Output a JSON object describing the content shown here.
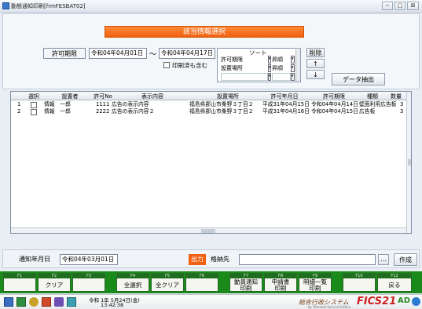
{
  "window": {
    "title": "動態通知印刷[frmFESBAT02]",
    "btn_min": "─",
    "btn_max": "□",
    "btn_close": "⊠"
  },
  "header": {
    "banner": "該当情報選択"
  },
  "filter": {
    "period_label": "許可期限",
    "date_from": "令和04年04月01日",
    "tilde": "〜",
    "date_to": "令和04年04月17日",
    "printed_label": "印刷済も含む"
  },
  "sort": {
    "title": "ソート",
    "rows": [
      {
        "field": "許可期限",
        "order": "昇順"
      },
      {
        "field": "設置場所",
        "order": "昇順"
      },
      {
        "field": "",
        "order": ""
      }
    ],
    "delete_label": "削除",
    "up_label": "↑",
    "down_label": "↓"
  },
  "extract_button": "データ抽出",
  "table": {
    "columns": [
      "選択",
      "設置者",
      "許可No",
      "表示内容",
      "設置場所",
      "許可年月日",
      "許可期限",
      "種類",
      "数量"
    ],
    "rows": [
      {
        "num": "1",
        "owner": "情報　一郎",
        "no": "1111",
        "content": "広告の表示内容",
        "place": "福島県郡山市桑野３丁目２",
        "date": "平成31年04月15日",
        "limit": "令和04年04月14日",
        "kind": "壁面利用広告板",
        "qty": "3"
      },
      {
        "num": "2",
        "owner": "情報　一郎",
        "no": "2222",
        "content": "広告の表示内容２",
        "place": "福島県郡山市桑野３丁目２",
        "date": "平成31年04月16日",
        "limit": "令和04年04月15日",
        "kind": "広告板",
        "qty": "3"
      }
    ]
  },
  "bottom": {
    "notice_label": "通知年月日",
    "notice_date": "令和04年03月01日",
    "output_label": "出力",
    "storage_label": "格納先",
    "storage_value": "",
    "browse_label": "...",
    "create_label": "作成"
  },
  "fkeys": [
    {
      "key": "F1",
      "label": ""
    },
    {
      "key": "F2",
      "label": "クリア"
    },
    {
      "key": "F3",
      "label": ""
    },
    {
      "key": "F4",
      "label": "全選択"
    },
    {
      "key": "F5",
      "label": "全クリア"
    },
    {
      "key": "F6",
      "label": ""
    },
    {
      "key": "F7",
      "label": "動員通知\n印刷"
    },
    {
      "key": "F8",
      "label": "申請書\n印刷"
    },
    {
      "key": "F9",
      "label": "明細一覧\n印刷"
    },
    {
      "key": "F10",
      "label": ""
    },
    {
      "key": "F11",
      "label": ""
    },
    {
      "key": "F12",
      "label": "戻る"
    }
  ],
  "taskbar": {
    "date": "令和 1年 5月24日(金)",
    "time": "13:42:38",
    "system_name": "総合行政システム",
    "brand": "FICS21",
    "brand_suffix": "AD",
    "subtitle": "by Terminal Service Edition"
  },
  "colors": {
    "banner": "#f06010",
    "fkey_bar": "#1a8a1a",
    "output": "#f06010",
    "brand": "#cc2020"
  }
}
